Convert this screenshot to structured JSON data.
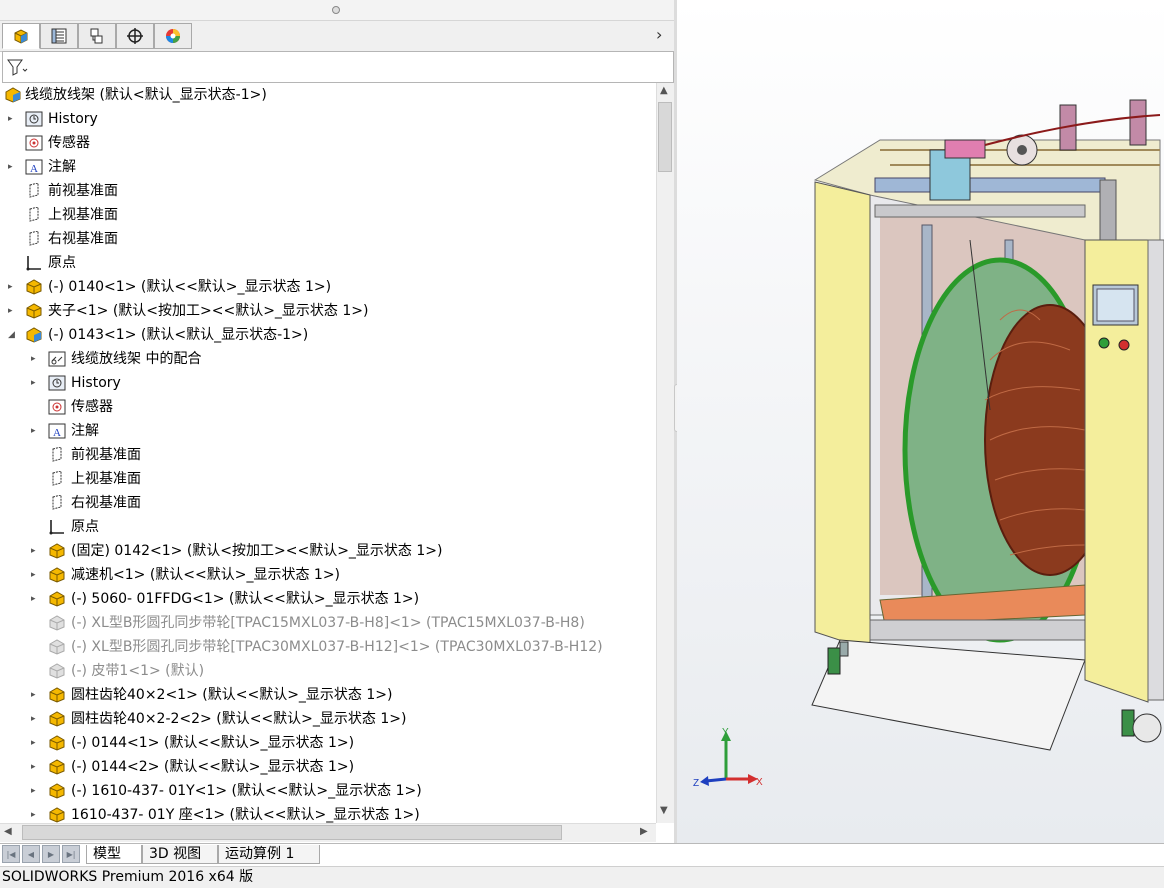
{
  "tabs": [
    {
      "name": "feature-manager",
      "icon": "feature-tree-icon"
    },
    {
      "name": "property-manager",
      "icon": "property-list-icon"
    },
    {
      "name": "configuration-manager",
      "icon": "configuration-icon"
    },
    {
      "name": "dimxpert-manager",
      "icon": "crosshair-icon"
    },
    {
      "name": "display-manager",
      "icon": "color-wheel-icon"
    }
  ],
  "filter": {
    "icon": "filter-icon"
  },
  "tree": {
    "root": "线缆放线架  (默认<默认_显示状态-1>)",
    "items": [
      {
        "label": "History",
        "level": 1,
        "arrow": true,
        "icon": "history"
      },
      {
        "label": "传感器",
        "level": 1,
        "arrow": false,
        "icon": "sensor"
      },
      {
        "label": "注解",
        "level": 1,
        "arrow": true,
        "icon": "annotation"
      },
      {
        "label": "前视基准面",
        "level": 1,
        "arrow": false,
        "icon": "plane"
      },
      {
        "label": "上视基准面",
        "level": 1,
        "arrow": false,
        "icon": "plane"
      },
      {
        "label": "右视基准面",
        "level": 1,
        "arrow": false,
        "icon": "plane"
      },
      {
        "label": "原点",
        "level": 1,
        "arrow": false,
        "icon": "origin"
      },
      {
        "label": "(-) 0140<1> (默认<<默认>_显示状态 1>)",
        "level": 1,
        "arrow": true,
        "icon": "part"
      },
      {
        "label": "夹子<1> (默认<按加工><<默认>_显示状态 1>)",
        "level": 1,
        "arrow": true,
        "icon": "part"
      },
      {
        "label": "(-) 0143<1> (默认<默认_显示状态-1>)",
        "level": 1,
        "arrow": "open",
        "icon": "assembly"
      },
      {
        "label": "线缆放线架 中的配合",
        "level": 2,
        "arrow": true,
        "icon": "mates"
      },
      {
        "label": "History",
        "level": 2,
        "arrow": true,
        "icon": "history"
      },
      {
        "label": "传感器",
        "level": 2,
        "arrow": false,
        "icon": "sensor"
      },
      {
        "label": "注解",
        "level": 2,
        "arrow": true,
        "icon": "annotation"
      },
      {
        "label": "前视基准面",
        "level": 2,
        "arrow": false,
        "icon": "plane"
      },
      {
        "label": "上视基准面",
        "level": 2,
        "arrow": false,
        "icon": "plane"
      },
      {
        "label": "右视基准面",
        "level": 2,
        "arrow": false,
        "icon": "plane"
      },
      {
        "label": "原点",
        "level": 2,
        "arrow": false,
        "icon": "origin"
      },
      {
        "label": "(固定) 0142<1> (默认<按加工><<默认>_显示状态 1>)",
        "level": 2,
        "arrow": true,
        "icon": "part"
      },
      {
        "label": "减速机<1> (默认<<默认>_显示状态 1>)",
        "level": 2,
        "arrow": true,
        "icon": "part"
      },
      {
        "label": "(-) 5060- 01FFDG<1> (默认<<默认>_显示状态 1>)",
        "level": 2,
        "arrow": true,
        "icon": "part"
      },
      {
        "label": "(-) XL型B形圆孔同步带轮[TPAC15MXL037-B-H8]<1> (TPAC15MXL037-B-H8)",
        "level": 2,
        "arrow": false,
        "icon": "part-dim",
        "dim": true
      },
      {
        "label": "(-) XL型B形圆孔同步带轮[TPAC30MXL037-B-H12]<1> (TPAC30MXL037-B-H12)",
        "level": 2,
        "arrow": false,
        "icon": "part-dim",
        "dim": true
      },
      {
        "label": "(-) 皮带1<1> (默认)",
        "level": 2,
        "arrow": false,
        "icon": "part-dim",
        "dim": true
      },
      {
        "label": "圆柱齿轮40×2<1> (默认<<默认>_显示状态 1>)",
        "level": 2,
        "arrow": true,
        "icon": "part"
      },
      {
        "label": "圆柱齿轮40×2-2<2> (默认<<默认>_显示状态 1>)",
        "level": 2,
        "arrow": true,
        "icon": "part"
      },
      {
        "label": "(-) 0144<1> (默认<<默认>_显示状态 1>)",
        "level": 2,
        "arrow": true,
        "icon": "part"
      },
      {
        "label": "(-) 0144<2> (默认<<默认>_显示状态 1>)",
        "level": 2,
        "arrow": true,
        "icon": "part"
      },
      {
        "label": "(-) 1610-437- 01Y<1> (默认<<默认>_显示状态 1>)",
        "level": 2,
        "arrow": true,
        "icon": "part"
      },
      {
        "label": "1610-437- 01Y 座<1> (默认<<默认>_显示状态 1>)",
        "level": 2,
        "arrow": true,
        "icon": "part"
      }
    ]
  },
  "bottom_tabs": [
    "模型",
    "3D 视图",
    "运动算例 1"
  ],
  "active_bottom_tab": "模型",
  "status": "SOLIDWORKS Premium 2016 x64 版",
  "triad": {
    "x": "X",
    "y": "Y",
    "z": "Z"
  },
  "colors": {
    "accent": "#f5b800",
    "machine_yellow": "#f4ee9c",
    "reel_green": "#7fb286",
    "coil": "#8b3a1e"
  }
}
